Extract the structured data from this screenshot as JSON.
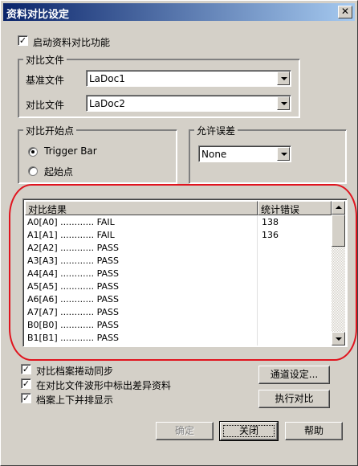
{
  "window": {
    "title": "资料对比设定",
    "close_symbol": "✕"
  },
  "enable_compare": {
    "label": "启动资料对比功能",
    "checked": true
  },
  "compare_files": {
    "group_title": "对比文件",
    "base_label": "基准文件",
    "base_value": "LaDoc1",
    "compare_label": "对比文件",
    "compare_value": "LaDoc2"
  },
  "start_point": {
    "group_title": "对比开始点",
    "options": [
      {
        "label": "Trigger Bar",
        "selected": true
      },
      {
        "label": "起始点",
        "selected": false
      }
    ]
  },
  "tolerance": {
    "group_title": "允许误差",
    "value": "None"
  },
  "results": {
    "columns": [
      "对比结果",
      "统计错误"
    ],
    "rows": [
      {
        "result": "A0[A0] ............ FAIL",
        "errors": "138"
      },
      {
        "result": "A1[A1] ............ FAIL",
        "errors": "136"
      },
      {
        "result": "A2[A2] ............ PASS",
        "errors": ""
      },
      {
        "result": "A3[A3] ............ PASS",
        "errors": ""
      },
      {
        "result": "A4[A4] ............ PASS",
        "errors": ""
      },
      {
        "result": "A5[A5] ............ PASS",
        "errors": ""
      },
      {
        "result": "A6[A6] ............ PASS",
        "errors": ""
      },
      {
        "result": "A7[A7] ............ PASS",
        "errors": ""
      },
      {
        "result": "B0[B0] ............ PASS",
        "errors": ""
      },
      {
        "result": "B1[B1] ............ PASS",
        "errors": ""
      }
    ]
  },
  "options": [
    {
      "label": "对比档案捲动同步",
      "checked": true
    },
    {
      "label": "在对比文件波形中标出差异资料",
      "checked": true
    },
    {
      "label": "档案上下并排显示",
      "checked": true
    }
  ],
  "buttons": {
    "channel_settings": "通道设定...",
    "run_compare": "执行对比",
    "ok": "确定",
    "close": "关闭",
    "help": "帮助"
  },
  "colors": {
    "title_bar_start": "#0a246a",
    "title_bar_end": "#a6caf0",
    "dialog_face": "#d4d0c8",
    "highlight_ellipse": "#e0141e"
  },
  "check_mark": "✓"
}
